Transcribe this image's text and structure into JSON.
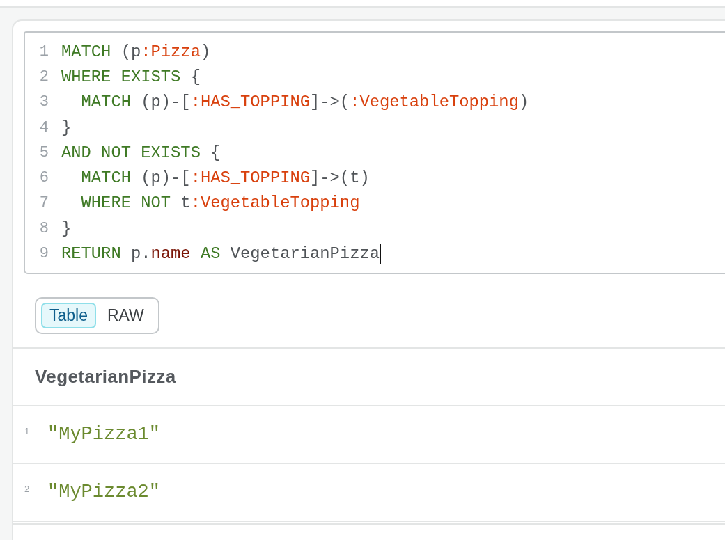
{
  "editor": {
    "focused": true,
    "lines": [
      {
        "number": "1",
        "tokens": [
          {
            "kind": "keyword",
            "text": "MATCH"
          },
          {
            "kind": "plain",
            "text": " (p"
          },
          {
            "kind": "label",
            "text": ":Pizza"
          },
          {
            "kind": "plain",
            "text": ")"
          }
        ]
      },
      {
        "number": "2",
        "tokens": [
          {
            "kind": "keyword",
            "text": "WHERE EXISTS"
          },
          {
            "kind": "plain",
            "text": " {"
          }
        ]
      },
      {
        "number": "3",
        "tokens": [
          {
            "kind": "keyword",
            "text": "  MATCH"
          },
          {
            "kind": "plain",
            "text": " (p)-["
          },
          {
            "kind": "label",
            "text": ":HAS_TOPPING"
          },
          {
            "kind": "plain",
            "text": "]->("
          },
          {
            "kind": "label",
            "text": ":VegetableTopping"
          },
          {
            "kind": "plain",
            "text": ")"
          }
        ]
      },
      {
        "number": "4",
        "tokens": [
          {
            "kind": "plain",
            "text": "}"
          }
        ]
      },
      {
        "number": "5",
        "tokens": [
          {
            "kind": "keyword",
            "text": "AND NOT EXISTS"
          },
          {
            "kind": "plain",
            "text": " {"
          }
        ]
      },
      {
        "number": "6",
        "tokens": [
          {
            "kind": "keyword",
            "text": "  MATCH"
          },
          {
            "kind": "plain",
            "text": " (p)-["
          },
          {
            "kind": "label",
            "text": ":HAS_TOPPING"
          },
          {
            "kind": "plain",
            "text": "]->(t)"
          }
        ]
      },
      {
        "number": "7",
        "tokens": [
          {
            "kind": "keyword",
            "text": "  WHERE NOT"
          },
          {
            "kind": "plain",
            "text": " t"
          },
          {
            "kind": "label",
            "text": ":VegetableTopping"
          }
        ]
      },
      {
        "number": "8",
        "tokens": [
          {
            "kind": "plain",
            "text": "}"
          }
        ]
      },
      {
        "number": "9",
        "tokens": [
          {
            "kind": "keyword",
            "text": "RETURN"
          },
          {
            "kind": "plain",
            "text": " p."
          },
          {
            "kind": "property",
            "text": "name"
          },
          {
            "kind": "keyword",
            "text": " AS"
          },
          {
            "kind": "plain",
            "text": " VegetarianPizza"
          }
        ]
      }
    ]
  },
  "view_tabs": [
    {
      "label": "Table",
      "selected": true
    },
    {
      "label": "RAW",
      "selected": false
    }
  ],
  "table": {
    "columns": [
      {
        "label": "VegetarianPizza"
      }
    ],
    "rows": [
      {
        "index": "1",
        "cells": [
          "\"MyPizza1\""
        ]
      },
      {
        "index": "2",
        "cells": [
          "\"MyPizza2\""
        ]
      }
    ]
  }
}
